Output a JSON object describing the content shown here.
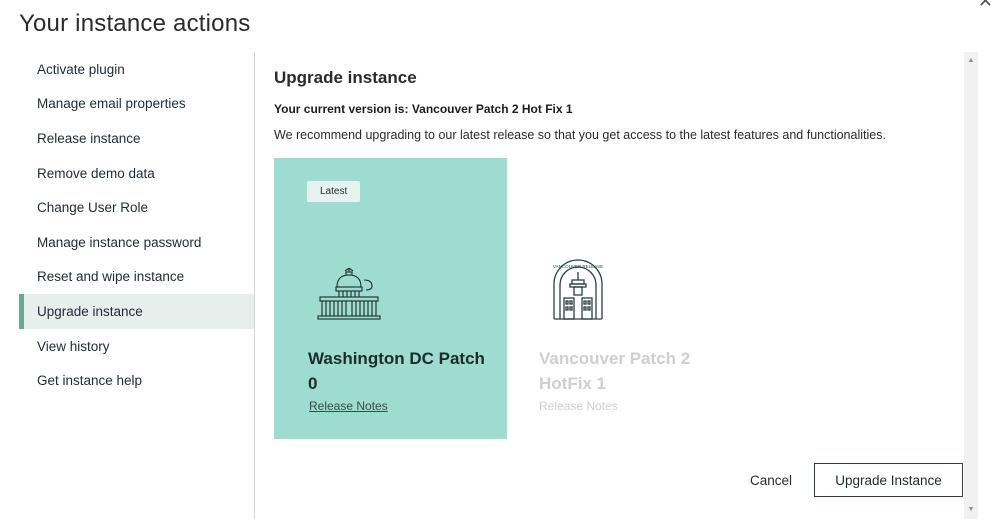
{
  "dialog": {
    "title": "Your instance actions",
    "close_glyph": "✕"
  },
  "sidebar": {
    "items": [
      {
        "label": "Activate plugin"
      },
      {
        "label": "Manage email properties"
      },
      {
        "label": "Release instance"
      },
      {
        "label": "Remove demo data"
      },
      {
        "label": "Change User Role"
      },
      {
        "label": "Manage instance password"
      },
      {
        "label": "Reset and wipe instance"
      },
      {
        "label": "Upgrade instance",
        "active": true
      },
      {
        "label": "View history"
      },
      {
        "label": "Get instance help"
      }
    ]
  },
  "main": {
    "title": "Upgrade instance",
    "current_version": "Your current version is: Vancouver Patch 2 Hot Fix 1",
    "recommendation": "We recommend upgrading to our latest release so that you get access to the latest features and functionalities.",
    "cards": [
      {
        "badge": "Latest",
        "name": "Washington DC Patch 0",
        "notes": "Release Notes",
        "icon": "capitol-building-icon",
        "selected": true
      },
      {
        "name": "Vancouver Patch 2 HotFix 1",
        "notes": "Release Notes",
        "icon": "vancouver-release-seal-icon",
        "icon_text": "VANCOUVER RELEASE",
        "selected": false
      }
    ]
  },
  "footer": {
    "cancel_label": "Cancel",
    "upgrade_label": "Upgrade Instance"
  },
  "scrollbar": {
    "up_glyph": "▲",
    "down_glyph": "▼"
  },
  "colors": {
    "selected_card": "#9edcd0",
    "active_nav_bg": "#e6efec",
    "active_nav_bar": "#6aa892",
    "button_border": "#2b4040"
  }
}
